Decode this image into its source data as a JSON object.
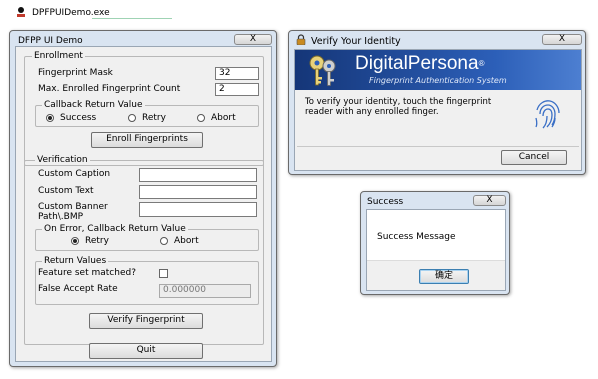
{
  "taskbar": {
    "title": "DPFPUIDemo.exe"
  },
  "main": {
    "title": "DFPP UI Demo",
    "close": "X",
    "enrollment": {
      "group_label": "Enrollment",
      "mask_label": "Fingerprint Mask",
      "mask_value": "32",
      "max_label": "Max. Enrolled Fingerprint Count",
      "max_value": "2",
      "callback": {
        "group_label": "Callback Return Value",
        "options": [
          "Success",
          "Retry",
          "Abort"
        ],
        "selected": "Success"
      },
      "enroll_button": "Enroll Fingerprints"
    },
    "verification": {
      "group_label": "Verification",
      "caption_label": "Custom Caption",
      "caption_value": "",
      "text_label": "Custom Text",
      "text_value": "",
      "banner_label_1": "Custom Banner",
      "banner_label_2": "Path\\.BMP",
      "banner_value": "",
      "on_error": {
        "group_label": "On Error, Callback Return Value",
        "options": [
          "Retry",
          "Abort"
        ],
        "selected": "Retry"
      },
      "return_values": {
        "group_label": "Return Values",
        "matched_label": "Feature set matched?",
        "matched_checked": false,
        "far_label": "False Accept Rate",
        "far_value": "0.000000"
      },
      "verify_button": "Verify Fingerprint"
    },
    "quit_button": "Quit"
  },
  "verify_dialog": {
    "title": "Verify Your Identity",
    "brand": "DigitalPersona",
    "brand_reg": "®",
    "subtitle": "Fingerprint Authentication System",
    "message": "To verify your identity, touch the fingerprint reader with any enrolled finger.",
    "cancel": "Cancel",
    "close": "X",
    "colors": {
      "banner": "#1a3f8f",
      "banner_light": "#2c5fb8"
    }
  },
  "success_dialog": {
    "title": "Success",
    "message": "Success Message",
    "ok": "确定",
    "close": "X"
  }
}
